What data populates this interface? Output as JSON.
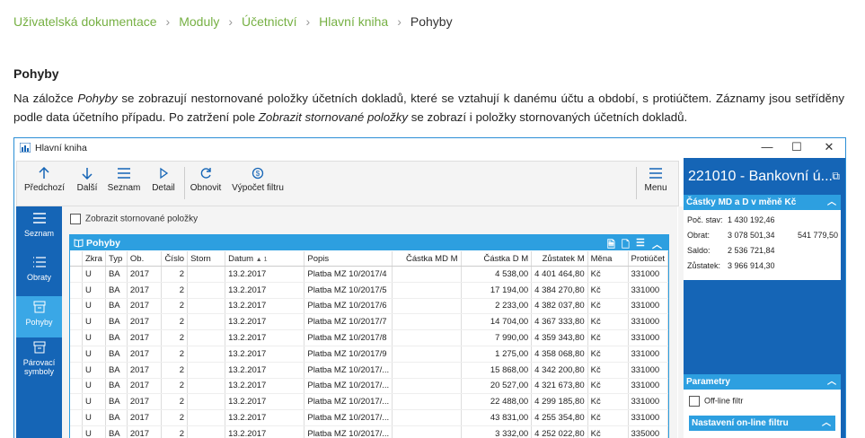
{
  "breadcrumb": {
    "items": [
      "Uživatelská dokumentace",
      "Moduly",
      "Účetnictví",
      "Hlavní kniha"
    ],
    "current": "Pohyby"
  },
  "section_title": "Pohyby",
  "paragraph": {
    "p1": "Na záložce ",
    "i1": "Pohyby",
    "p2": " se zobrazují nestornované položky účetních dokladů, které se vztahují k danému účtu a období, s protiúčtem. Záznamy jsou setříděny podle data účetního případu. Po zatržení pole ",
    "i2": "Zobrazit stornované položky",
    "p3": " se zobrazí i položky stornovaných účetních dokladů."
  },
  "window": {
    "title": "Hlavní kniha",
    "minimize": "—",
    "maximize": "☐",
    "close": "✕"
  },
  "toolbar": {
    "prev": "Předchozí",
    "next": "Další",
    "list": "Seznam",
    "detail": "Detail",
    "refresh": "Obnovit",
    "filter_calc": "Výpočet filtru",
    "menu": "Menu"
  },
  "nav": {
    "items": [
      "Seznam",
      "Obraty",
      "Pohyby",
      "Párovací symboly"
    ],
    "active": "Pohyby"
  },
  "show_cancelled_label": "Zobrazit stornované položky",
  "grid": {
    "title": "Pohyby",
    "columns": [
      "Zkra",
      "Typ",
      "Ob.",
      "Číslo",
      "Storn",
      "Datum",
      "Popis",
      "Částka MD M",
      "Částka D M",
      "Zůstatek M",
      "Měna",
      "Protiúčet"
    ],
    "sort_indicator": "▲ 1",
    "rows": [
      [
        "U",
        "BA",
        "2017",
        "2",
        "",
        "13.2.2017",
        "Platba MZ 10/2017/4",
        "",
        "4 538,00",
        "4 401 464,80",
        "Kč",
        "331000"
      ],
      [
        "U",
        "BA",
        "2017",
        "2",
        "",
        "13.2.2017",
        "Platba MZ 10/2017/5",
        "",
        "17 194,00",
        "4 384 270,80",
        "Kč",
        "331000"
      ],
      [
        "U",
        "BA",
        "2017",
        "2",
        "",
        "13.2.2017",
        "Platba MZ 10/2017/6",
        "",
        "2 233,00",
        "4 382 037,80",
        "Kč",
        "331000"
      ],
      [
        "U",
        "BA",
        "2017",
        "2",
        "",
        "13.2.2017",
        "Platba MZ 10/2017/7",
        "",
        "14 704,00",
        "4 367 333,80",
        "Kč",
        "331000"
      ],
      [
        "U",
        "BA",
        "2017",
        "2",
        "",
        "13.2.2017",
        "Platba MZ 10/2017/8",
        "",
        "7 990,00",
        "4 359 343,80",
        "Kč",
        "331000"
      ],
      [
        "U",
        "BA",
        "2017",
        "2",
        "",
        "13.2.2017",
        "Platba MZ 10/2017/9",
        "",
        "1 275,00",
        "4 358 068,80",
        "Kč",
        "331000"
      ],
      [
        "U",
        "BA",
        "2017",
        "2",
        "",
        "13.2.2017",
        "Platba MZ 10/2017/...",
        "",
        "15 868,00",
        "4 342 200,80",
        "Kč",
        "331000"
      ],
      [
        "U",
        "BA",
        "2017",
        "2",
        "",
        "13.2.2017",
        "Platba MZ 10/2017/...",
        "",
        "20 527,00",
        "4 321 673,80",
        "Kč",
        "331000"
      ],
      [
        "U",
        "BA",
        "2017",
        "2",
        "",
        "13.2.2017",
        "Platba MZ 10/2017/...",
        "",
        "22 488,00",
        "4 299 185,80",
        "Kč",
        "331000"
      ],
      [
        "U",
        "BA",
        "2017",
        "2",
        "",
        "13.2.2017",
        "Platba MZ 10/2017/...",
        "",
        "43 831,00",
        "4 255 354,80",
        "Kč",
        "331000"
      ],
      [
        "U",
        "BA",
        "2017",
        "2",
        "",
        "13.2.2017",
        "Platba MZ 10/2017/...",
        "",
        "3 332,00",
        "4 252 022,80",
        "Kč",
        "335000"
      ]
    ]
  },
  "right_panel": {
    "account_title": "221010 - Bankovní ú...",
    "amounts_header": "Částky MD a D v měně Kč",
    "start_label": "Poč. stav:",
    "start_value": "1 430 192,46",
    "turnover_label": "Obrat:",
    "turnover_md": "3 078 501,34",
    "turnover_d": "541 779,50",
    "balance_label": "Saldo:",
    "balance_value": "2 536 721,84",
    "rest_label": "Zůstatek:",
    "rest_value": "3 966 914,30",
    "params_header": "Parametry",
    "offline_label": "Off-line filtr",
    "online_header": "Nastavení on-line filtru"
  },
  "colors": {
    "accent": "#1565b6",
    "header_blue": "#2d9fe0",
    "link_green": "#76b043"
  }
}
